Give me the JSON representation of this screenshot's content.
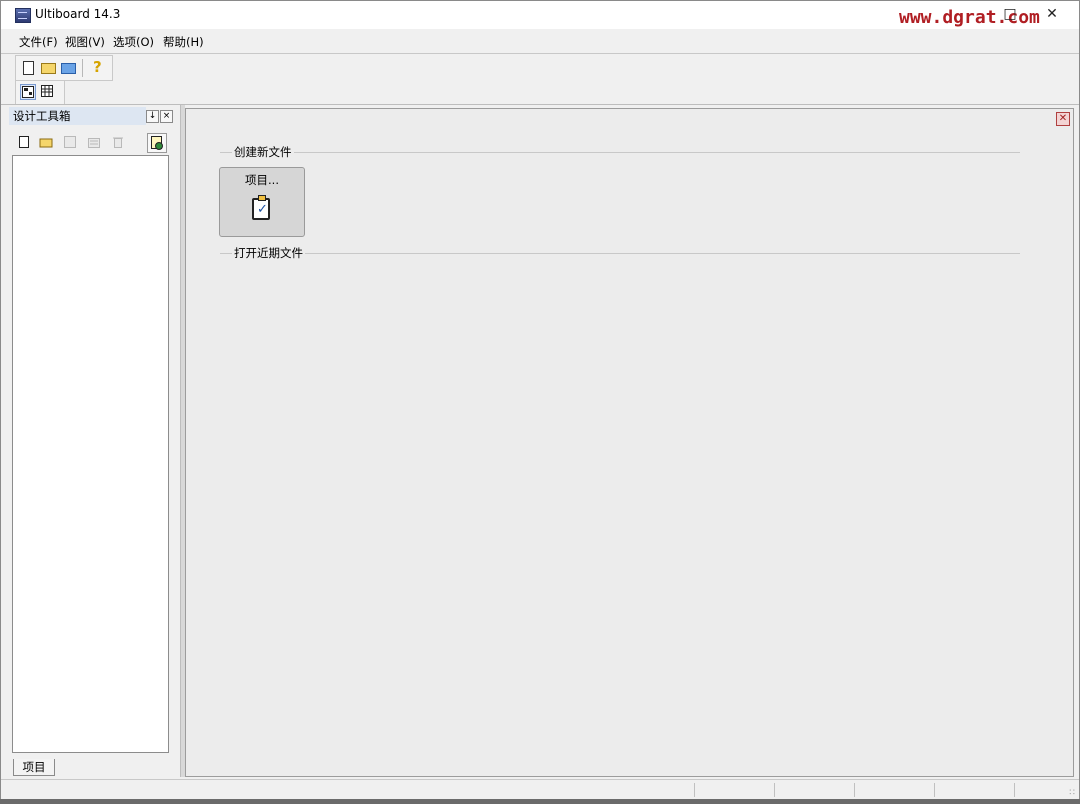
{
  "window": {
    "title": "Ultiboard 14.3",
    "watermark": "www.dgrat.com"
  },
  "menu": [
    "文件(F)",
    "视图(V)",
    "选项(O)",
    "帮助(H)"
  ],
  "toolbar": {
    "icons": [
      "new-file-icon",
      "open-folder-icon",
      "open-project-icon",
      "help-icon"
    ]
  },
  "view_toolbar": {
    "icons": [
      "layout-view-icon",
      "spreadsheet-view-icon"
    ]
  },
  "toolbox": {
    "title": "设计工具箱",
    "tab_label": "项目",
    "tools": [
      "new-icon",
      "open-icon",
      "save-icon",
      "properties-icon",
      "delete-icon",
      "layout-icon"
    ]
  },
  "start_page": {
    "create_section": "创建新文件",
    "project_button": "项目...",
    "recent_section": "打开近期文件"
  }
}
